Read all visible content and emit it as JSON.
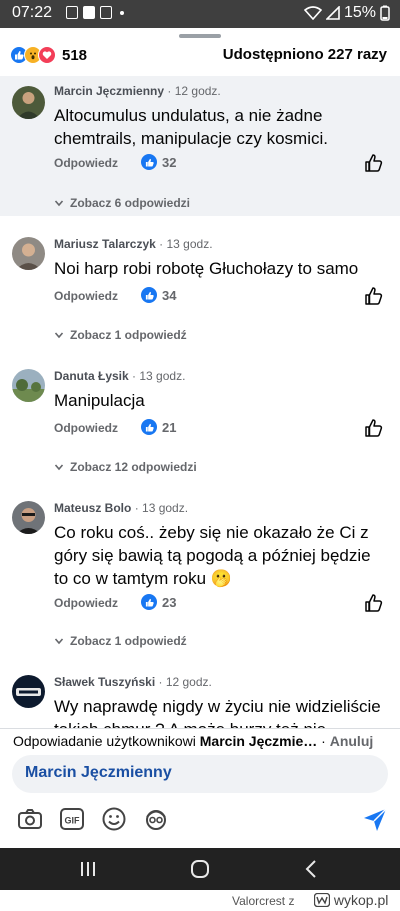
{
  "status_bar": {
    "time": "07:22",
    "battery": "15%"
  },
  "post_header": {
    "reaction_count": "518",
    "shares": "Udostępniono 227 razy"
  },
  "comments": [
    {
      "author": "Marcin Jęczmienny",
      "time": "· 12 godz.",
      "text": "Altocumulus undulatus, a nie żadne chemtrails, manipulacje czy kosmici.",
      "reply_label": "Odpowiedz",
      "likes": "32",
      "view_replies": "Zobacz 6 odpowiedzi"
    },
    {
      "author": "Mariusz Talarczyk",
      "time": "· 13 godz.",
      "text": "Noi harp robi robotę Głuchołazy to samo",
      "reply_label": "Odpowiedz",
      "likes": "34",
      "view_replies": "Zobacz 1 odpowiedź"
    },
    {
      "author": "Danuta Łysik",
      "time": "· 13 godz.",
      "text": "Manipulacja",
      "reply_label": "Odpowiedz",
      "likes": "21",
      "view_replies": "Zobacz 12 odpowiedzi"
    },
    {
      "author": "Mateusz Bolo",
      "time": "· 13 godz.",
      "text": "Co roku coś.. żeby się nie okazało że Ci z góry się bawią tą pogodą a później będzie to co w tamtym roku 🫢",
      "reply_label": "Odpowiedz",
      "likes": "23",
      "view_replies": "Zobacz 1 odpowiedź"
    },
    {
      "author": "Sławek Tuszyński",
      "time": "· 12 godz.",
      "text": "Wy naprawdę nigdy w życiu nie widzieliście takich chmur ? A może burzy też nie"
    }
  ],
  "reply_box": {
    "prefix": "Odpowiadanie użytkownikowi ",
    "target": "Marcin Jęczmie…",
    "separator": " · ",
    "cancel": "Anuluj",
    "mention": "Marcin Jęczmienny"
  },
  "footer": {
    "creator": "Valorcrest z",
    "site": "wykop.pl"
  },
  "colors": {
    "accent": "#1877f2",
    "status_bar": "#3f3f3f",
    "nav_bar": "#222222",
    "highlight": "#f0f2f5"
  }
}
